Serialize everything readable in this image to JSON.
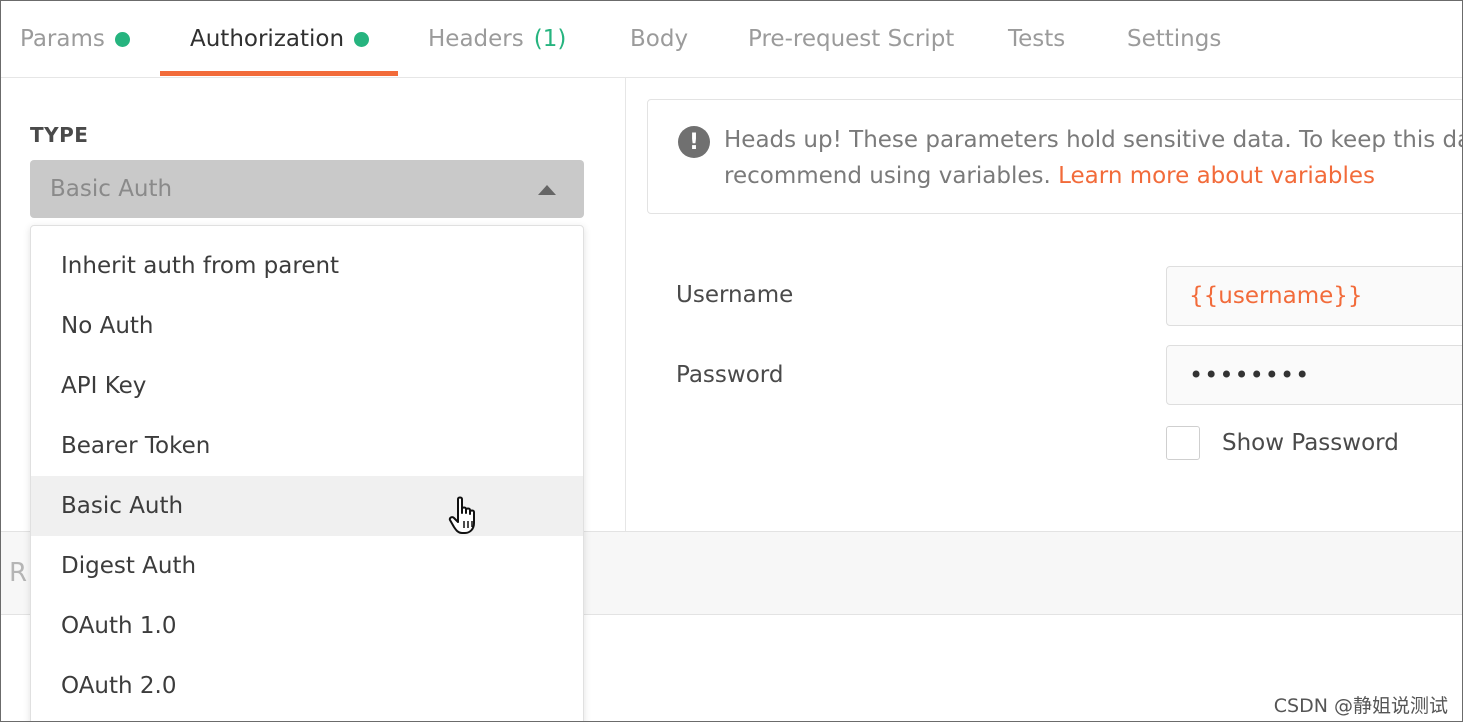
{
  "tabs": [
    {
      "label": "Params",
      "dot": true
    },
    {
      "label": "Authorization",
      "dot": true,
      "active": true
    },
    {
      "label": "Headers",
      "count": "(1)"
    },
    {
      "label": "Body"
    },
    {
      "label": "Pre-request Script"
    },
    {
      "label": "Tests"
    },
    {
      "label": "Settings"
    }
  ],
  "auth": {
    "type_label": "TYPE",
    "selected": "Basic Auth",
    "options": [
      "Inherit auth from parent",
      "No Auth",
      "API Key",
      "Bearer Token",
      "Basic Auth",
      "Digest Auth",
      "OAuth 1.0",
      "OAuth 2.0"
    ],
    "hovered_option": "Basic Auth"
  },
  "notice": {
    "line1": "Heads up! These parameters hold sensitive data. To keep this data",
    "line2": "recommend using variables. ",
    "link": "Learn more about variables"
  },
  "form": {
    "username_label": "Username",
    "username_value": "{{username}}",
    "password_label": "Password",
    "password_value": "••••••••",
    "show_password_label": "Show Password",
    "show_password_checked": false
  },
  "lower_strip_text": "R",
  "watermark": "CSDN @静姐说测试",
  "colors": {
    "accent": "#f26b3a",
    "dot_green": "#26b47f",
    "select_bg": "#c9c9c9"
  }
}
